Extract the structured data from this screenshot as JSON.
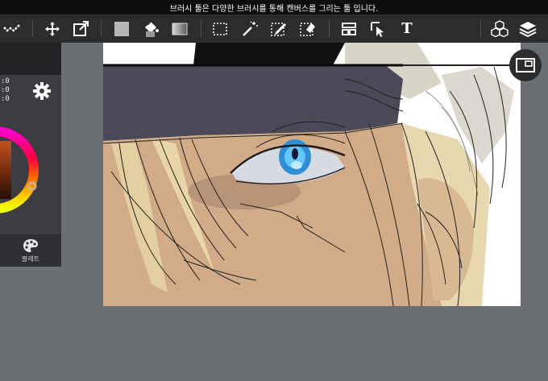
{
  "tooltip": {
    "text": "브러시 툴은 다양한 브러시를 통해 캔버스를 그리는 툴 입니다."
  },
  "toolbar": {
    "tools": [
      {
        "name": "brush-tool",
        "icon": "brush-check-icon"
      },
      {
        "name": "move-tool",
        "icon": "move-arrows-icon"
      },
      {
        "name": "transform-tool",
        "icon": "transform-icon"
      },
      {
        "name": "fill-color-tool",
        "icon": "fill-square-icon"
      },
      {
        "name": "bucket-tool",
        "icon": "paint-bucket-icon"
      },
      {
        "name": "gradient-tool",
        "icon": "gradient-icon"
      },
      {
        "name": "select-rect-tool",
        "icon": "dotted-rect-icon"
      },
      {
        "name": "magic-wand-tool",
        "icon": "magic-wand-icon"
      },
      {
        "name": "select-pen-tool",
        "icon": "selection-pen-icon"
      },
      {
        "name": "select-eraser-tool",
        "icon": "selection-eraser-icon"
      },
      {
        "name": "frame-divider-tool",
        "icon": "frame-layout-icon"
      },
      {
        "name": "operation-tool",
        "icon": "cursor-select-icon"
      },
      {
        "name": "text-tool",
        "icon": "text-t-icon"
      },
      {
        "name": "material-button",
        "icon": "cubes-icon"
      },
      {
        "name": "layer-button",
        "icon": "layers-icon"
      }
    ],
    "text_tool_label": "T"
  },
  "color_panel": {
    "rgb_values": [
      ":0",
      ":0",
      ":0"
    ],
    "settings_icon": "gear-icon",
    "palette_label": "팔레트",
    "palette_icon": "palette-icon",
    "colors": {
      "wheel_inner": "#7a2e0f"
    }
  },
  "canvas": {
    "navigator_icon": "navigator-window-icon"
  },
  "colors": {
    "background": "#6b6e73",
    "toolbar": "#2b2c2e",
    "tooltip": "#0d0d0d"
  }
}
